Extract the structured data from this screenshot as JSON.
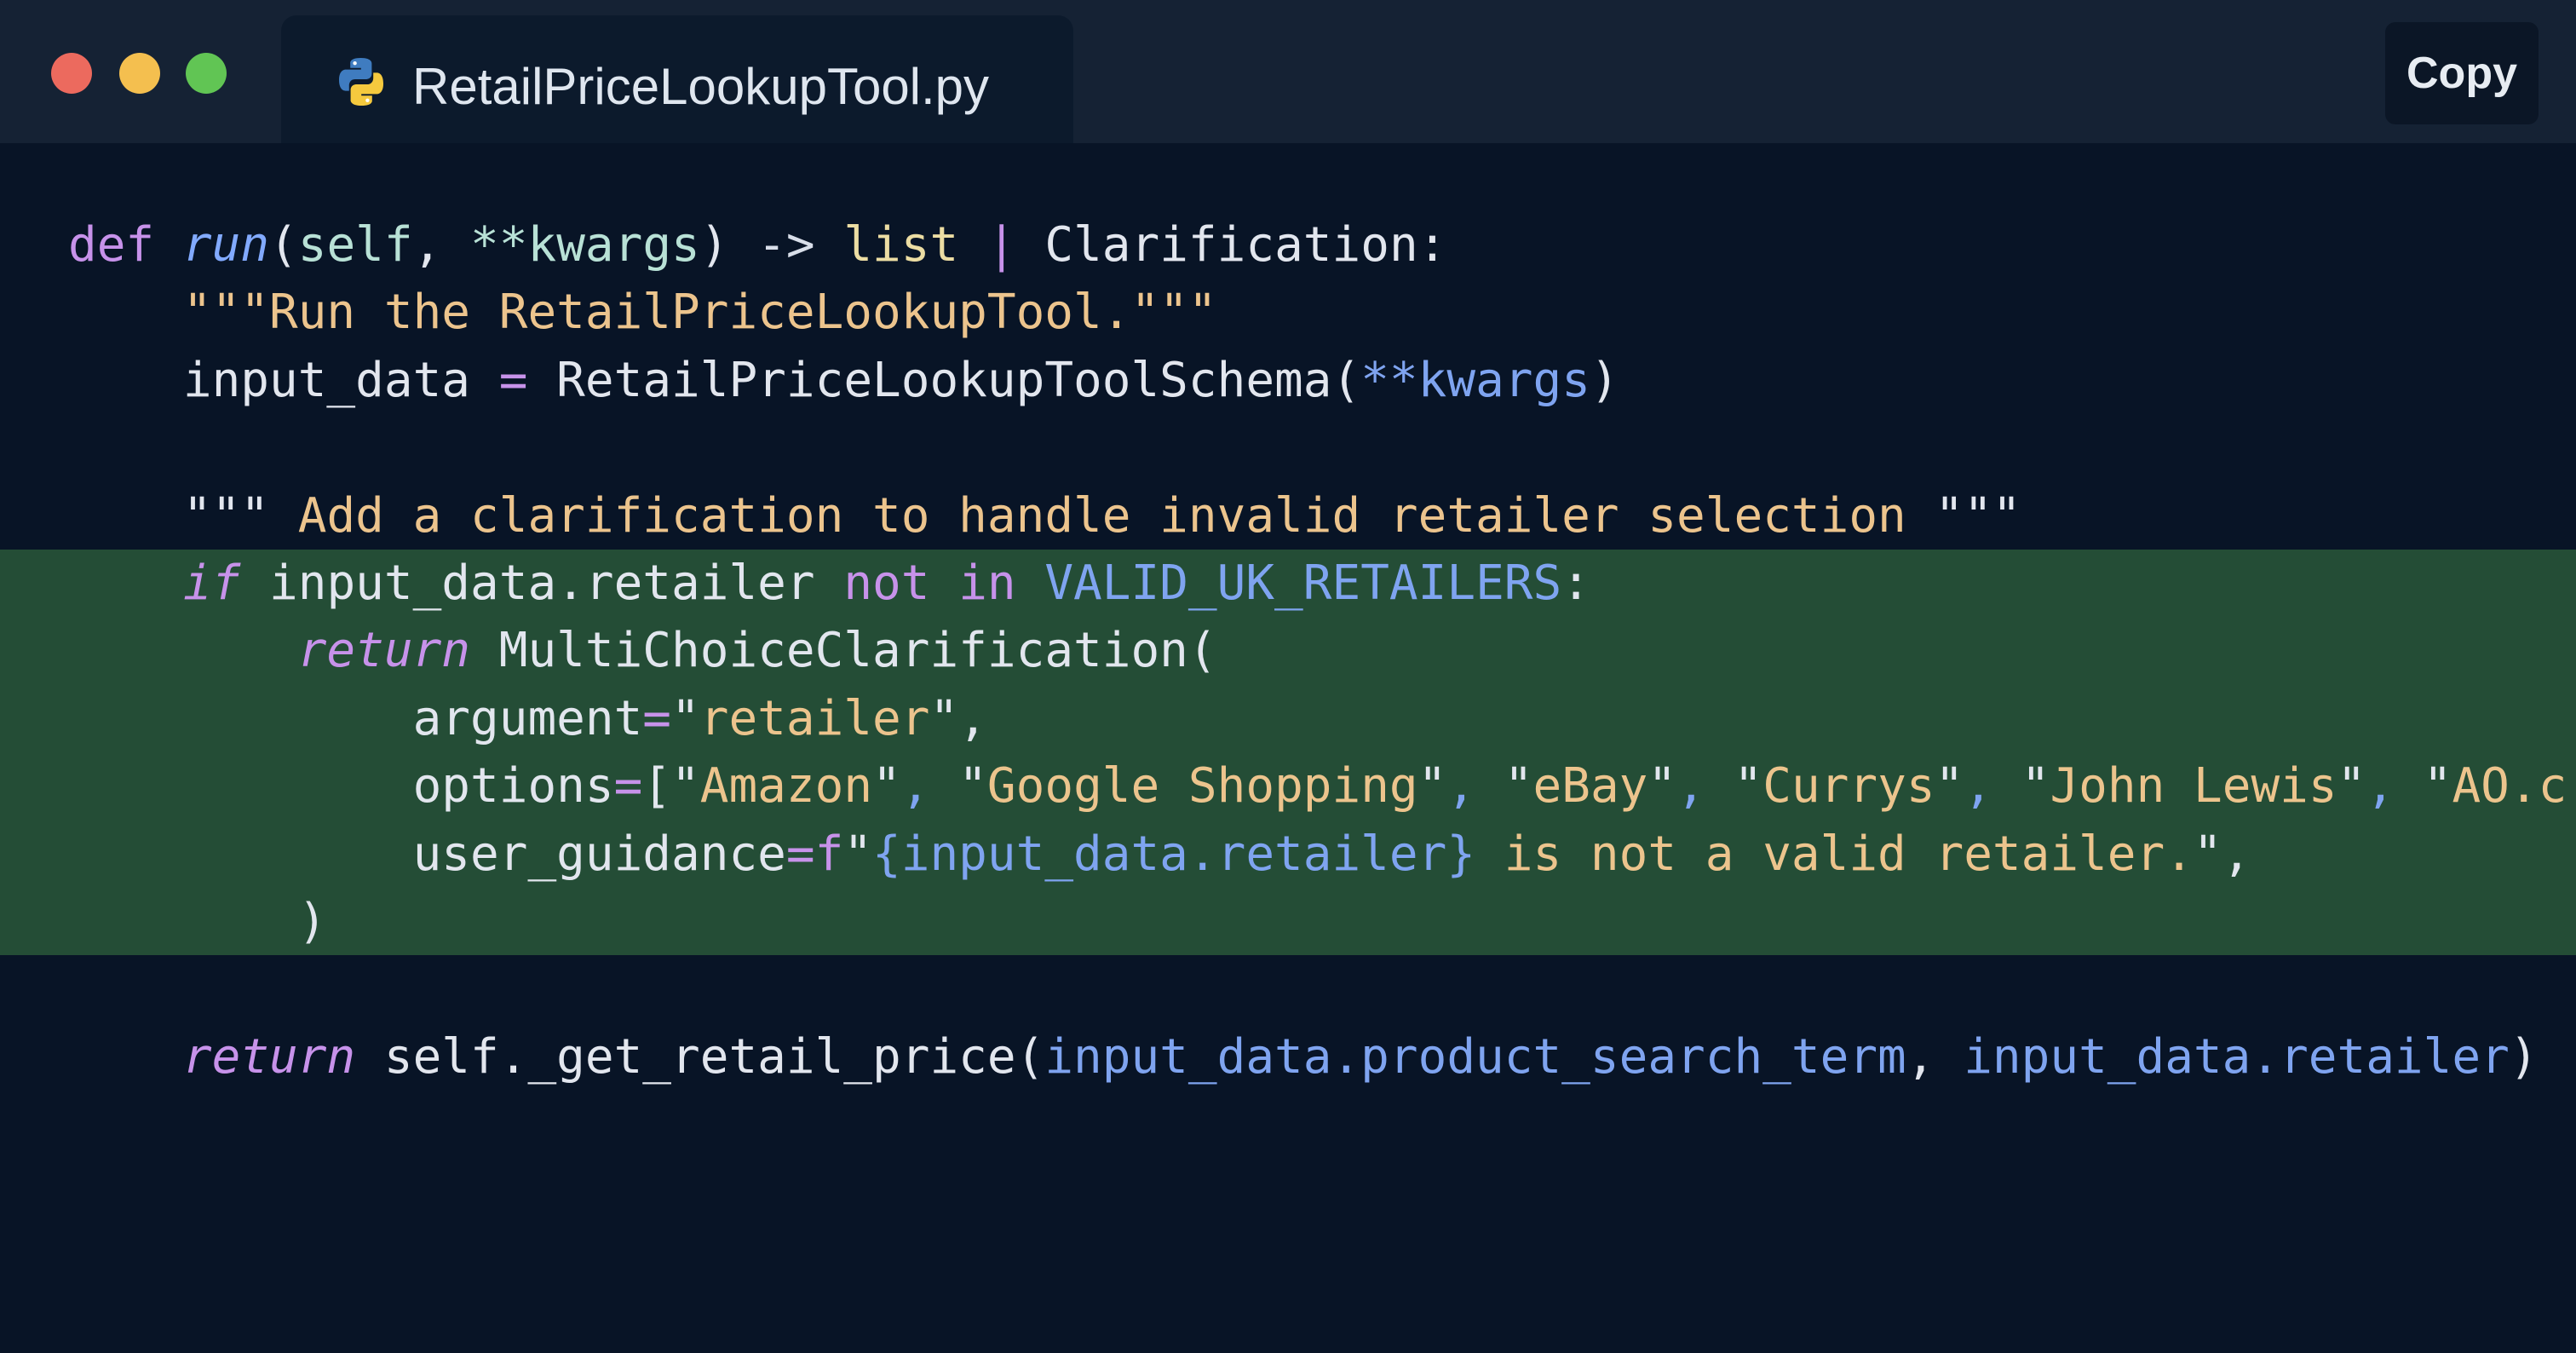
{
  "window": {
    "tab_title": "RetailPriceLookupTool.py",
    "tab_icon": "python-icon",
    "copy_label": "Copy"
  },
  "colors": {
    "background": "#081426",
    "titlebar": "#152234",
    "highlight": "#244d36",
    "keyword": "#c792ea",
    "string": "#ecc48d",
    "function": "#82aaff"
  },
  "code": {
    "language": "python",
    "highlighted_lines": [
      6,
      7,
      8,
      9,
      10,
      11
    ],
    "l1": {
      "kw_def": "def",
      "name": "run",
      "open": "(",
      "self": "self",
      "comma": ", ",
      "kwargs": "**kwargs",
      "close": ")",
      "arrow": " -> ",
      "list": "list",
      "pipe": " | ",
      "ret_type": "Clarification",
      "colon": ":"
    },
    "l2": {
      "docstring": "\"\"\"Run the RetailPriceLookupTool.\"\"\""
    },
    "l3": {
      "var": "input_data",
      "eq": " = ",
      "cls": "RetailPriceLookupToolSchema",
      "open": "(",
      "kwargs": "**kwargs",
      "close": ")"
    },
    "l5": {
      "q_open": "\"\"\"",
      "text": " Add a clarification to handle invalid retailer selection ",
      "q_close": "\"\"\""
    },
    "l6": {
      "kw_if": "if",
      "expr": " input_data.retailer ",
      "kw_not": "not",
      "sp": " ",
      "kw_in": "in",
      "const": " VALID_UK_RETAILERS",
      "colon": ":"
    },
    "l7": {
      "kw_return": "return",
      "cls": " MultiChoiceClarification("
    },
    "l8": {
      "arg": "argument",
      "eq": "=",
      "q1": "\"",
      "val": "retailer",
      "q2": "\"",
      "comma": ","
    },
    "l9": {
      "arg": "options",
      "eq": "=",
      "open": "[",
      "items": [
        "Amazon",
        "Google Shopping",
        "eBay",
        "Currys",
        "John Lewis",
        "AO.c"
      ]
    },
    "l10": {
      "arg": "user_guidance",
      "eq": "=",
      "prefix": "f",
      "q1": "\"",
      "interp": "{input_data.retailer}",
      "text": " is not a valid retailer.",
      "q2": "\"",
      "comma": ","
    },
    "l11": {
      "close": ")"
    },
    "l13": {
      "kw_return": "return",
      "call": " self._get_retail_price(",
      "a1": "input_data.product_search_term",
      "comma": ", ",
      "a2": "input_data.retailer",
      "close": ")"
    }
  }
}
